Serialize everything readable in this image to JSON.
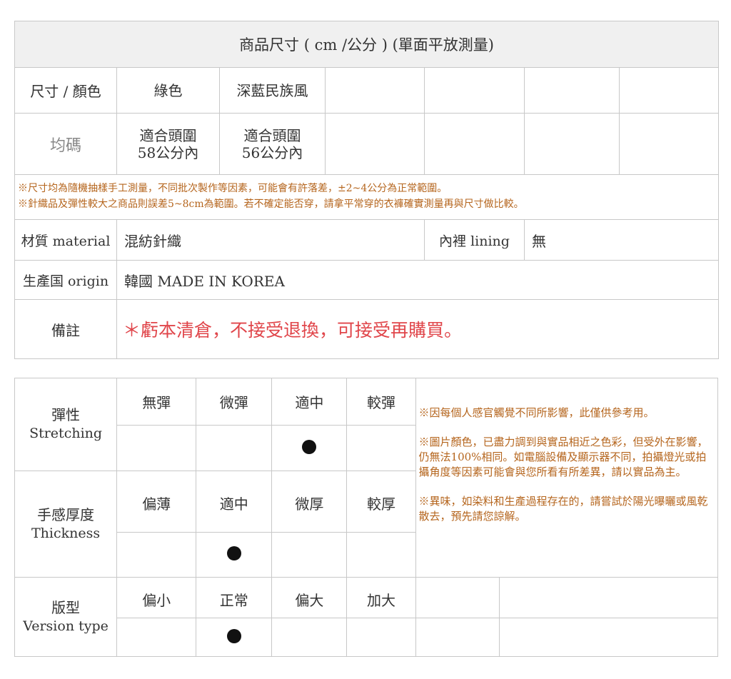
{
  "size_table": {
    "title": "商品尺寸 ( cm /公分 ) (單面平放測量)",
    "row1": {
      "label": "尺寸 / 顏色",
      "c1": "綠色",
      "c2": "深藍民族風"
    },
    "row2": {
      "label": "均碼",
      "c1": "適合頭圍\n58公分內",
      "c2": "適合頭圍\n56公分內"
    },
    "note1": "※尺寸均為隨機抽樣手工測量，不同批次製作等因素，可能會有許落差，±2~4公分為正常範圍。",
    "note2": "※針織品及彈性較大之商品則誤差5~8cm為範圍。若不確定能否穿，請拿平常穿的衣褲確實測量再與尺寸做比較。",
    "material": {
      "label": "材質 material",
      "value": "混紡針織",
      "lining_label": "內裡 lining",
      "lining_value": "無"
    },
    "origin": {
      "label": "生產国 origin",
      "value": "韓國 MADE IN KOREA"
    },
    "remark": {
      "label": "備註",
      "value": "＊虧本清倉，不接受退換，可接受再購買。"
    }
  },
  "attr_table": {
    "stretch": {
      "label_zh": "彈性",
      "label_en": "Stretching",
      "options": [
        "無彈",
        "微彈",
        "適中",
        "較彈"
      ],
      "selected": "適中"
    },
    "thickness": {
      "label_zh": "手感厚度",
      "label_en": "Thickness",
      "options": [
        "偏薄",
        "適中",
        "微厚",
        "較厚"
      ],
      "selected": "適中"
    },
    "version": {
      "label_zh": "版型",
      "label_en": "Version type",
      "options": [
        "偏小",
        "正常",
        "偏大",
        "加大"
      ],
      "selected": "正常"
    },
    "side_notes": [
      "※因每個人感官觸覺不同所影響，此僅供參考用。",
      "※圖片顏色，已盡力調到與實品相近之色彩，但受外在影響，仍無法100%相同。如電腦設備及顯示器不同，拍攝燈光或拍攝角度等因素可能會與您所看有所差異，請以實品為主。",
      "※異味，如染料和生產過程存在的，請嘗試於陽光曝曬或風乾散去，預先請您諒解。"
    ]
  }
}
